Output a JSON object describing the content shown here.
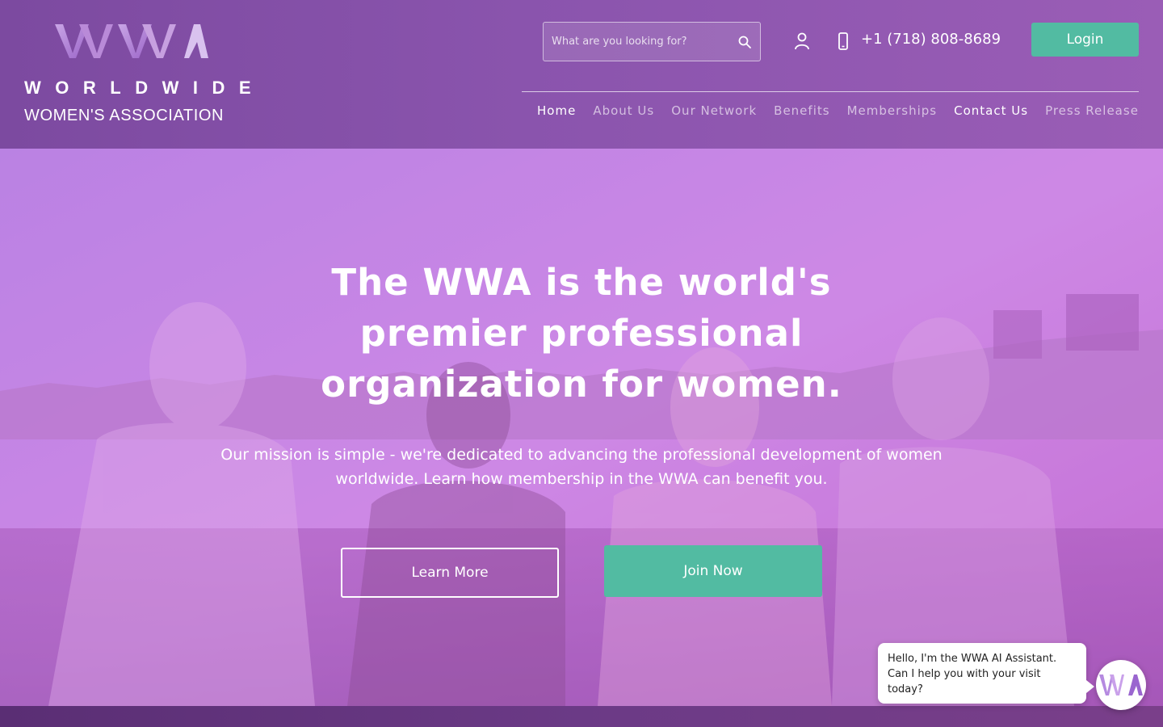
{
  "brand": {
    "logo_mark": "WWA",
    "name_line1": "WORLDWIDE",
    "name_line2": "WOMEN'S ASSOCIATION"
  },
  "header": {
    "search_placeholder": "What are you looking for?",
    "search_icon": "search-icon",
    "user_icon": "user-icon",
    "phone_icon": "phone-icon",
    "phone": "+1 (718) 808-8689",
    "login_label": "Login"
  },
  "nav": {
    "items": [
      {
        "label": "Home",
        "state": "active"
      },
      {
        "label": "About Us",
        "state": "normal"
      },
      {
        "label": "Our Network",
        "state": "normal"
      },
      {
        "label": "Benefits",
        "state": "normal"
      },
      {
        "label": "Memberships",
        "state": "normal"
      },
      {
        "label": "Contact Us",
        "state": "highlight"
      },
      {
        "label": "Press Release",
        "state": "normal"
      }
    ]
  },
  "hero": {
    "title": "The WWA is the world's premier professional organization for women.",
    "subtitle": "Our mission is simple - we're dedicated to advancing the professional development of women worldwide. Learn how membership in the WWA can benefit you.",
    "learn_more_label": "Learn More",
    "join_now_label": "Join Now"
  },
  "chat": {
    "message": "Hello, I'm the WWA AI Assistant. Can I help you with your visit today?",
    "avatar_text": "WWA"
  },
  "colors": {
    "accent_green": "#52bba2",
    "header_purple": "#8a54ad",
    "hero_overlay": "#c98ae8"
  }
}
